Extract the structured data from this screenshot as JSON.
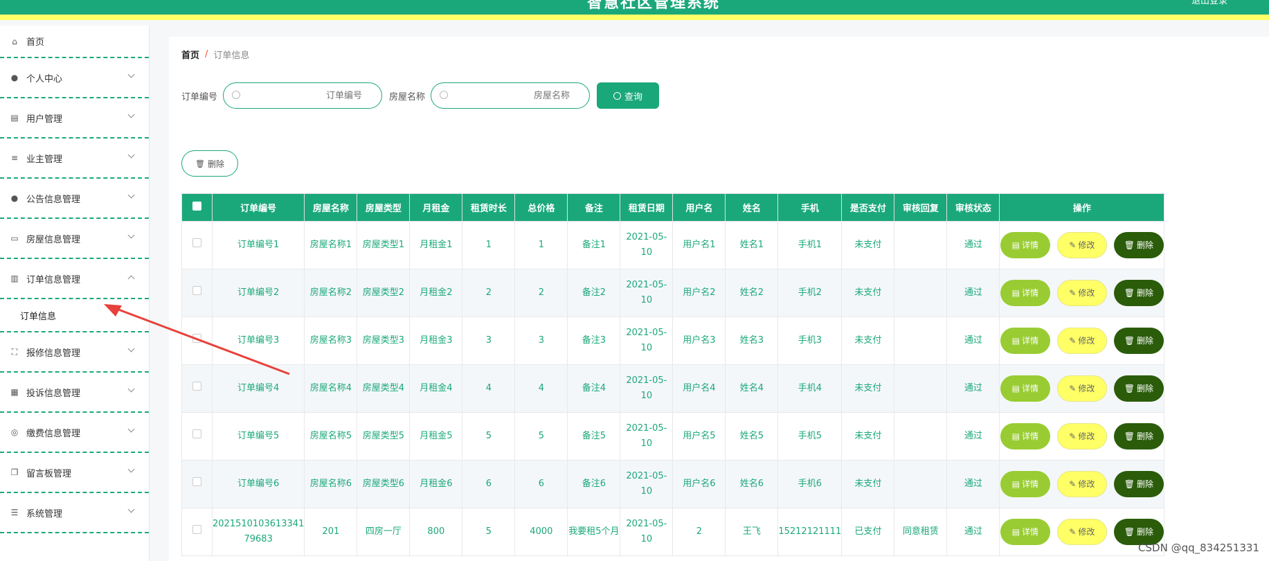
{
  "header": {
    "title": "智慧社区管理系统",
    "right_text": "退出登录"
  },
  "sidebar": {
    "items": [
      {
        "label": "首页",
        "icon": "home-icon",
        "glyph": "⌂",
        "expandable": false
      },
      {
        "label": "个人中心",
        "icon": "user-icon",
        "glyph": "●",
        "expandable": true
      },
      {
        "label": "用户管理",
        "icon": "clipboard-icon",
        "glyph": "▤",
        "expandable": true
      },
      {
        "label": "业主管理",
        "icon": "sliders-icon",
        "glyph": "≡",
        "expandable": true
      },
      {
        "label": "公告信息管理",
        "icon": "user-icon",
        "glyph": "●",
        "expandable": true
      },
      {
        "label": "房屋信息管理",
        "icon": "briefcase-icon",
        "glyph": "▭",
        "expandable": true
      },
      {
        "label": "订单信息管理",
        "icon": "bar-chart-icon",
        "glyph": "▥",
        "expandable": true,
        "open": true
      },
      {
        "label": "报修信息管理",
        "icon": "scan-icon",
        "glyph": "⛶",
        "expandable": true
      },
      {
        "label": "投诉信息管理",
        "icon": "book-icon",
        "glyph": "▦",
        "expandable": true
      },
      {
        "label": "缴费信息管理",
        "icon": "gauge-icon",
        "glyph": "◎",
        "expandable": true
      },
      {
        "label": "留言板管理",
        "icon": "copy-icon",
        "glyph": "❐",
        "expandable": true
      },
      {
        "label": "系统管理",
        "icon": "menu-icon",
        "glyph": "☰",
        "expandable": true
      }
    ],
    "submenu_label": "订单信息"
  },
  "breadcrumb": {
    "home": "首页",
    "separator": "/",
    "current": "订单信息"
  },
  "search": {
    "order_label": "订单编号",
    "order_placeholder": "订单编号",
    "house_label": "房屋名称",
    "house_placeholder": "房屋名称",
    "query_label": "查询"
  },
  "delete_button": "删除",
  "table": {
    "columns": [
      "订单编号",
      "房屋名称",
      "房屋类型",
      "月租金",
      "租赁时长",
      "总价格",
      "备注",
      "租赁日期",
      "用户名",
      "姓名",
      "手机",
      "是否支付",
      "审核回复",
      "审核状态",
      "操作"
    ],
    "rows": [
      [
        "订单编号1",
        "房屋名称1",
        "房屋类型1",
        "月租金1",
        "1",
        "1",
        "备注1",
        "2021-05-10",
        "用户名1",
        "姓名1",
        "手机1",
        "未支付",
        "",
        "通过"
      ],
      [
        "订单编号2",
        "房屋名称2",
        "房屋类型2",
        "月租金2",
        "2",
        "2",
        "备注2",
        "2021-05-10",
        "用户名2",
        "姓名2",
        "手机2",
        "未支付",
        "",
        "通过"
      ],
      [
        "订单编号3",
        "房屋名称3",
        "房屋类型3",
        "月租金3",
        "3",
        "3",
        "备注3",
        "2021-05-10",
        "用户名3",
        "姓名3",
        "手机3",
        "未支付",
        "",
        "通过"
      ],
      [
        "订单编号4",
        "房屋名称4",
        "房屋类型4",
        "月租金4",
        "4",
        "4",
        "备注4",
        "2021-05-10",
        "用户名4",
        "姓名4",
        "手机4",
        "未支付",
        "",
        "通过"
      ],
      [
        "订单编号5",
        "房屋名称5",
        "房屋类型5",
        "月租金5",
        "5",
        "5",
        "备注5",
        "2021-05-10",
        "用户名5",
        "姓名5",
        "手机5",
        "未支付",
        "",
        "通过"
      ],
      [
        "订单编号6",
        "房屋名称6",
        "房屋类型6",
        "月租金6",
        "6",
        "6",
        "备注6",
        "2021-05-10",
        "用户名6",
        "姓名6",
        "手机6",
        "未支付",
        "",
        "通过"
      ],
      [
        "2021510103613341 79683",
        "201",
        "四房一厅",
        "800",
        "5",
        "4000",
        "我要租5个月",
        "2021-05-10",
        "2",
        "王飞",
        "15212121111",
        "已支付",
        "同意租赁",
        "通过"
      ]
    ],
    "actions": {
      "detail": "详情",
      "edit": "修改",
      "delete": "删除"
    }
  },
  "colors": {
    "accent": "#1aa87a",
    "highlight": "#ffff66",
    "detail": "#99cc33",
    "delete": "#2a5c0a",
    "arrow": "#e8403a"
  },
  "watermark": "CSDN @qq_834251331"
}
